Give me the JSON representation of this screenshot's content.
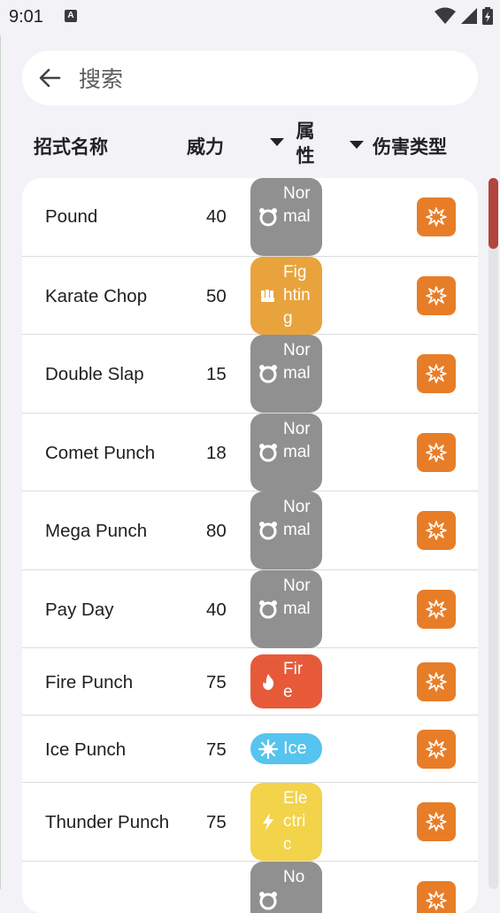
{
  "status_bar": {
    "time": "9:01",
    "notification_badge": "A"
  },
  "search": {
    "placeholder": "搜索"
  },
  "header": {
    "name_label": "招式名称",
    "power_label": "威力",
    "type_label": "属性",
    "damage_label": "伤害类型"
  },
  "colors": {
    "normal": "#909090",
    "fighting": "#e9a33d",
    "fire": "#e65a3a",
    "ice": "#55c4ee",
    "electric": "#f2d34a",
    "damage_button": "#e87d28",
    "scroll_thumb": "#b0463c"
  },
  "moves": [
    {
      "name": "Pound",
      "power": "40",
      "type": "Normal",
      "type_icon": "normal-type-icon",
      "damage_icon": "physical-damage-icon"
    },
    {
      "name": "Karate Chop",
      "power": "50",
      "type": "Fighting",
      "type_icon": "fighting-type-icon",
      "damage_icon": "physical-damage-icon"
    },
    {
      "name": "Double Slap",
      "power": "15",
      "type": "Normal",
      "type_icon": "normal-type-icon",
      "damage_icon": "physical-damage-icon"
    },
    {
      "name": "Comet Punch",
      "power": "18",
      "type": "Normal",
      "type_icon": "normal-type-icon",
      "damage_icon": "physical-damage-icon"
    },
    {
      "name": "Mega Punch",
      "power": "80",
      "type": "Normal",
      "type_icon": "normal-type-icon",
      "damage_icon": "physical-damage-icon"
    },
    {
      "name": "Pay Day",
      "power": "40",
      "type": "Normal",
      "type_icon": "normal-type-icon",
      "damage_icon": "physical-damage-icon"
    },
    {
      "name": "Fire Punch",
      "power": "75",
      "type": "Fire",
      "type_icon": "fire-type-icon",
      "damage_icon": "physical-damage-icon"
    },
    {
      "name": "Ice Punch",
      "power": "75",
      "type": "Ice",
      "type_icon": "ice-type-icon",
      "damage_icon": "physical-damage-icon"
    },
    {
      "name": "Thunder Punch",
      "power": "75",
      "type": "Electric",
      "type_icon": "electric-type-icon",
      "damage_icon": "physical-damage-icon"
    },
    {
      "name": "",
      "power": "",
      "type": "No",
      "type_icon": "normal-type-icon",
      "damage_icon": "physical-damage-icon"
    }
  ]
}
